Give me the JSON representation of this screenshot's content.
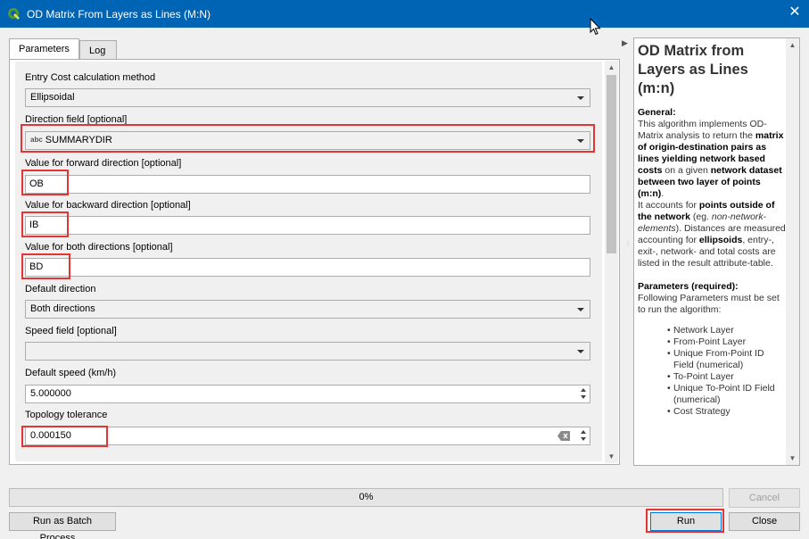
{
  "window": {
    "title": "OD Matrix From Layers as Lines (M:N)",
    "close_glyph": "✕",
    "title_bar_color": "#0064b4"
  },
  "tabs": [
    {
      "label": "Parameters",
      "active": true
    },
    {
      "label": "Log",
      "active": false
    }
  ],
  "params": {
    "entry_cost": {
      "label": "Entry Cost calculation method",
      "value": "Ellipsoidal"
    },
    "direction_field": {
      "label": "Direction field [optional]",
      "type_badge": "abc",
      "value": "SUMMARYDIR"
    },
    "forward": {
      "label": "Value for forward direction [optional]",
      "value": "OB"
    },
    "backward": {
      "label": "Value for backward direction [optional]",
      "value": "IB"
    },
    "both": {
      "label": "Value for both directions [optional]",
      "value": "BD"
    },
    "default_direction": {
      "label": "Default direction",
      "value": "Both directions"
    },
    "speed_field": {
      "label": "Speed field [optional]",
      "value": ""
    },
    "default_speed": {
      "label": "Default speed (km/h)",
      "value": "5.000000"
    },
    "topology": {
      "label": "Topology tolerance",
      "value": "0.000150"
    }
  },
  "help": {
    "title": "OD Matrix from Layers as Lines (m:n)",
    "general_heading": "General:",
    "general_1": "This algorithm implements OD-Matrix analysis to return the",
    "general_1b": "matrix of origin-destination pairs as lines yielding network based costs",
    "general_2": "on a given",
    "general_2b": "network dataset between two layer of points (m:n)",
    "general_3": "It accounts for",
    "general_3b": "points outside of the network",
    "general_3c": "(eg.",
    "general_3d": "non-network-elements",
    "general_3e": "). Distances are measured accounting for",
    "general_3f": "ellipsoids",
    "general_3g": ", entry-, exit-, network- and total costs are listed in the result attribute-table.",
    "params_heading": "Parameters (required):",
    "params_intro": "Following Parameters must be set to run the algorithm:",
    "items": [
      "Network Layer",
      "From-Point Layer",
      "Unique From-Point ID Field (numerical)",
      "To-Point Layer",
      "Unique To-Point ID Field (numerical)",
      "Cost Strategy"
    ]
  },
  "progress": {
    "text": "0%",
    "value": 0
  },
  "buttons": {
    "cancel": "Cancel",
    "batch": "Run as Batch Process…",
    "run": "Run",
    "close": "Close"
  },
  "highlight_color": "#e43434"
}
